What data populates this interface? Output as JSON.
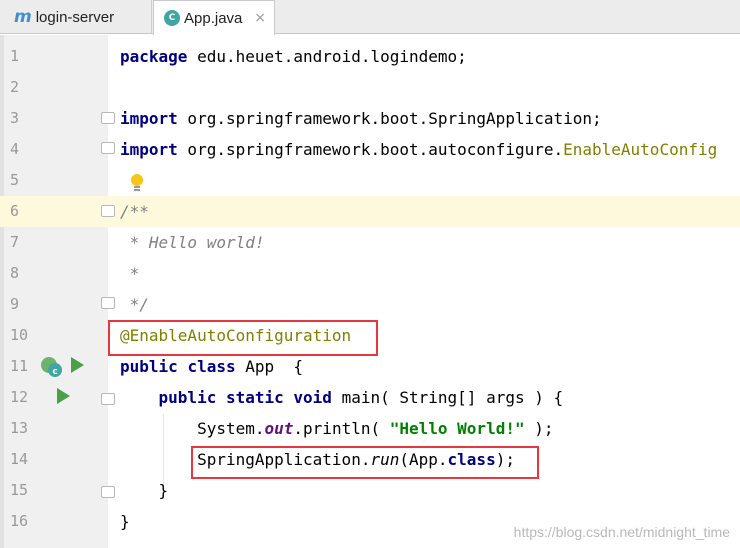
{
  "tabs": [
    {
      "label": "login-server",
      "icon": "module-icon",
      "icon_glyph": "m",
      "active": false
    },
    {
      "label": "App.java",
      "icon": "java-class-icon",
      "icon_glyph": "C",
      "active": true
    }
  ],
  "tab_close_glyph": "×",
  "caret_line": 6,
  "lines": [
    {
      "n": "1",
      "segments": [
        {
          "t": "package",
          "c": "kw"
        },
        {
          "t": " edu.heuet.android.logindemo;",
          "c": ""
        }
      ]
    },
    {
      "n": "2",
      "segments": []
    },
    {
      "n": "3",
      "segments": [
        {
          "t": "import",
          "c": "kw"
        },
        {
          "t": " org.springframework.boot.SpringApplication;",
          "c": ""
        }
      ]
    },
    {
      "n": "4",
      "segments": [
        {
          "t": "import",
          "c": "kw"
        },
        {
          "t": " org.springframework.boot.autoconfigure.",
          "c": ""
        },
        {
          "t": "EnableAutoConfig",
          "c": "ann"
        }
      ]
    },
    {
      "n": "5",
      "segments": []
    },
    {
      "n": "6",
      "segments": [
        {
          "t": "/**",
          "c": "cmt"
        }
      ]
    },
    {
      "n": "7",
      "segments": [
        {
          "t": " * Hello world!",
          "c": "cmt"
        }
      ]
    },
    {
      "n": "8",
      "segments": [
        {
          "t": " *",
          "c": "cmt"
        }
      ]
    },
    {
      "n": "9",
      "segments": [
        {
          "t": " */",
          "c": "cmt"
        }
      ]
    },
    {
      "n": "10",
      "segments": [
        {
          "t": "@EnableAutoConfiguration",
          "c": "ann"
        }
      ]
    },
    {
      "n": "11",
      "segments": [
        {
          "t": "public",
          "c": "kw"
        },
        {
          "t": " ",
          "c": ""
        },
        {
          "t": "class",
          "c": "kw"
        },
        {
          "t": " App  {",
          "c": ""
        }
      ]
    },
    {
      "n": "12",
      "segments": [
        {
          "t": "    ",
          "c": ""
        },
        {
          "t": "public",
          "c": "kw"
        },
        {
          "t": " ",
          "c": ""
        },
        {
          "t": "static",
          "c": "kw"
        },
        {
          "t": " ",
          "c": ""
        },
        {
          "t": "void",
          "c": "kw"
        },
        {
          "t": " main( String[] args ) {",
          "c": ""
        }
      ]
    },
    {
      "n": "13",
      "segments": [
        {
          "t": "        System.",
          "c": ""
        },
        {
          "t": "out",
          "c": "fld"
        },
        {
          "t": ".println( ",
          "c": ""
        },
        {
          "t": "\"Hello World!\"",
          "c": "str"
        },
        {
          "t": " );",
          "c": ""
        }
      ]
    },
    {
      "n": "14",
      "segments": [
        {
          "t": "        SpringApplication.",
          "c": ""
        },
        {
          "t": "run",
          "c": "itl"
        },
        {
          "t": "(App.",
          "c": ""
        },
        {
          "t": "class",
          "c": "kw"
        },
        {
          "t": ");",
          "c": ""
        }
      ]
    },
    {
      "n": "15",
      "segments": [
        {
          "t": "    }",
          "c": ""
        }
      ]
    },
    {
      "n": "16",
      "segments": [
        {
          "t": "}",
          "c": ""
        }
      ]
    }
  ],
  "watermark": "https://blog.csdn.net/midnight_time",
  "colors": {
    "keyword": "#000080",
    "annotation": "#808000",
    "comment": "#808080",
    "string": "#008000",
    "highlight_box": "#e8383d",
    "caret_line": "#fcf9dd"
  }
}
